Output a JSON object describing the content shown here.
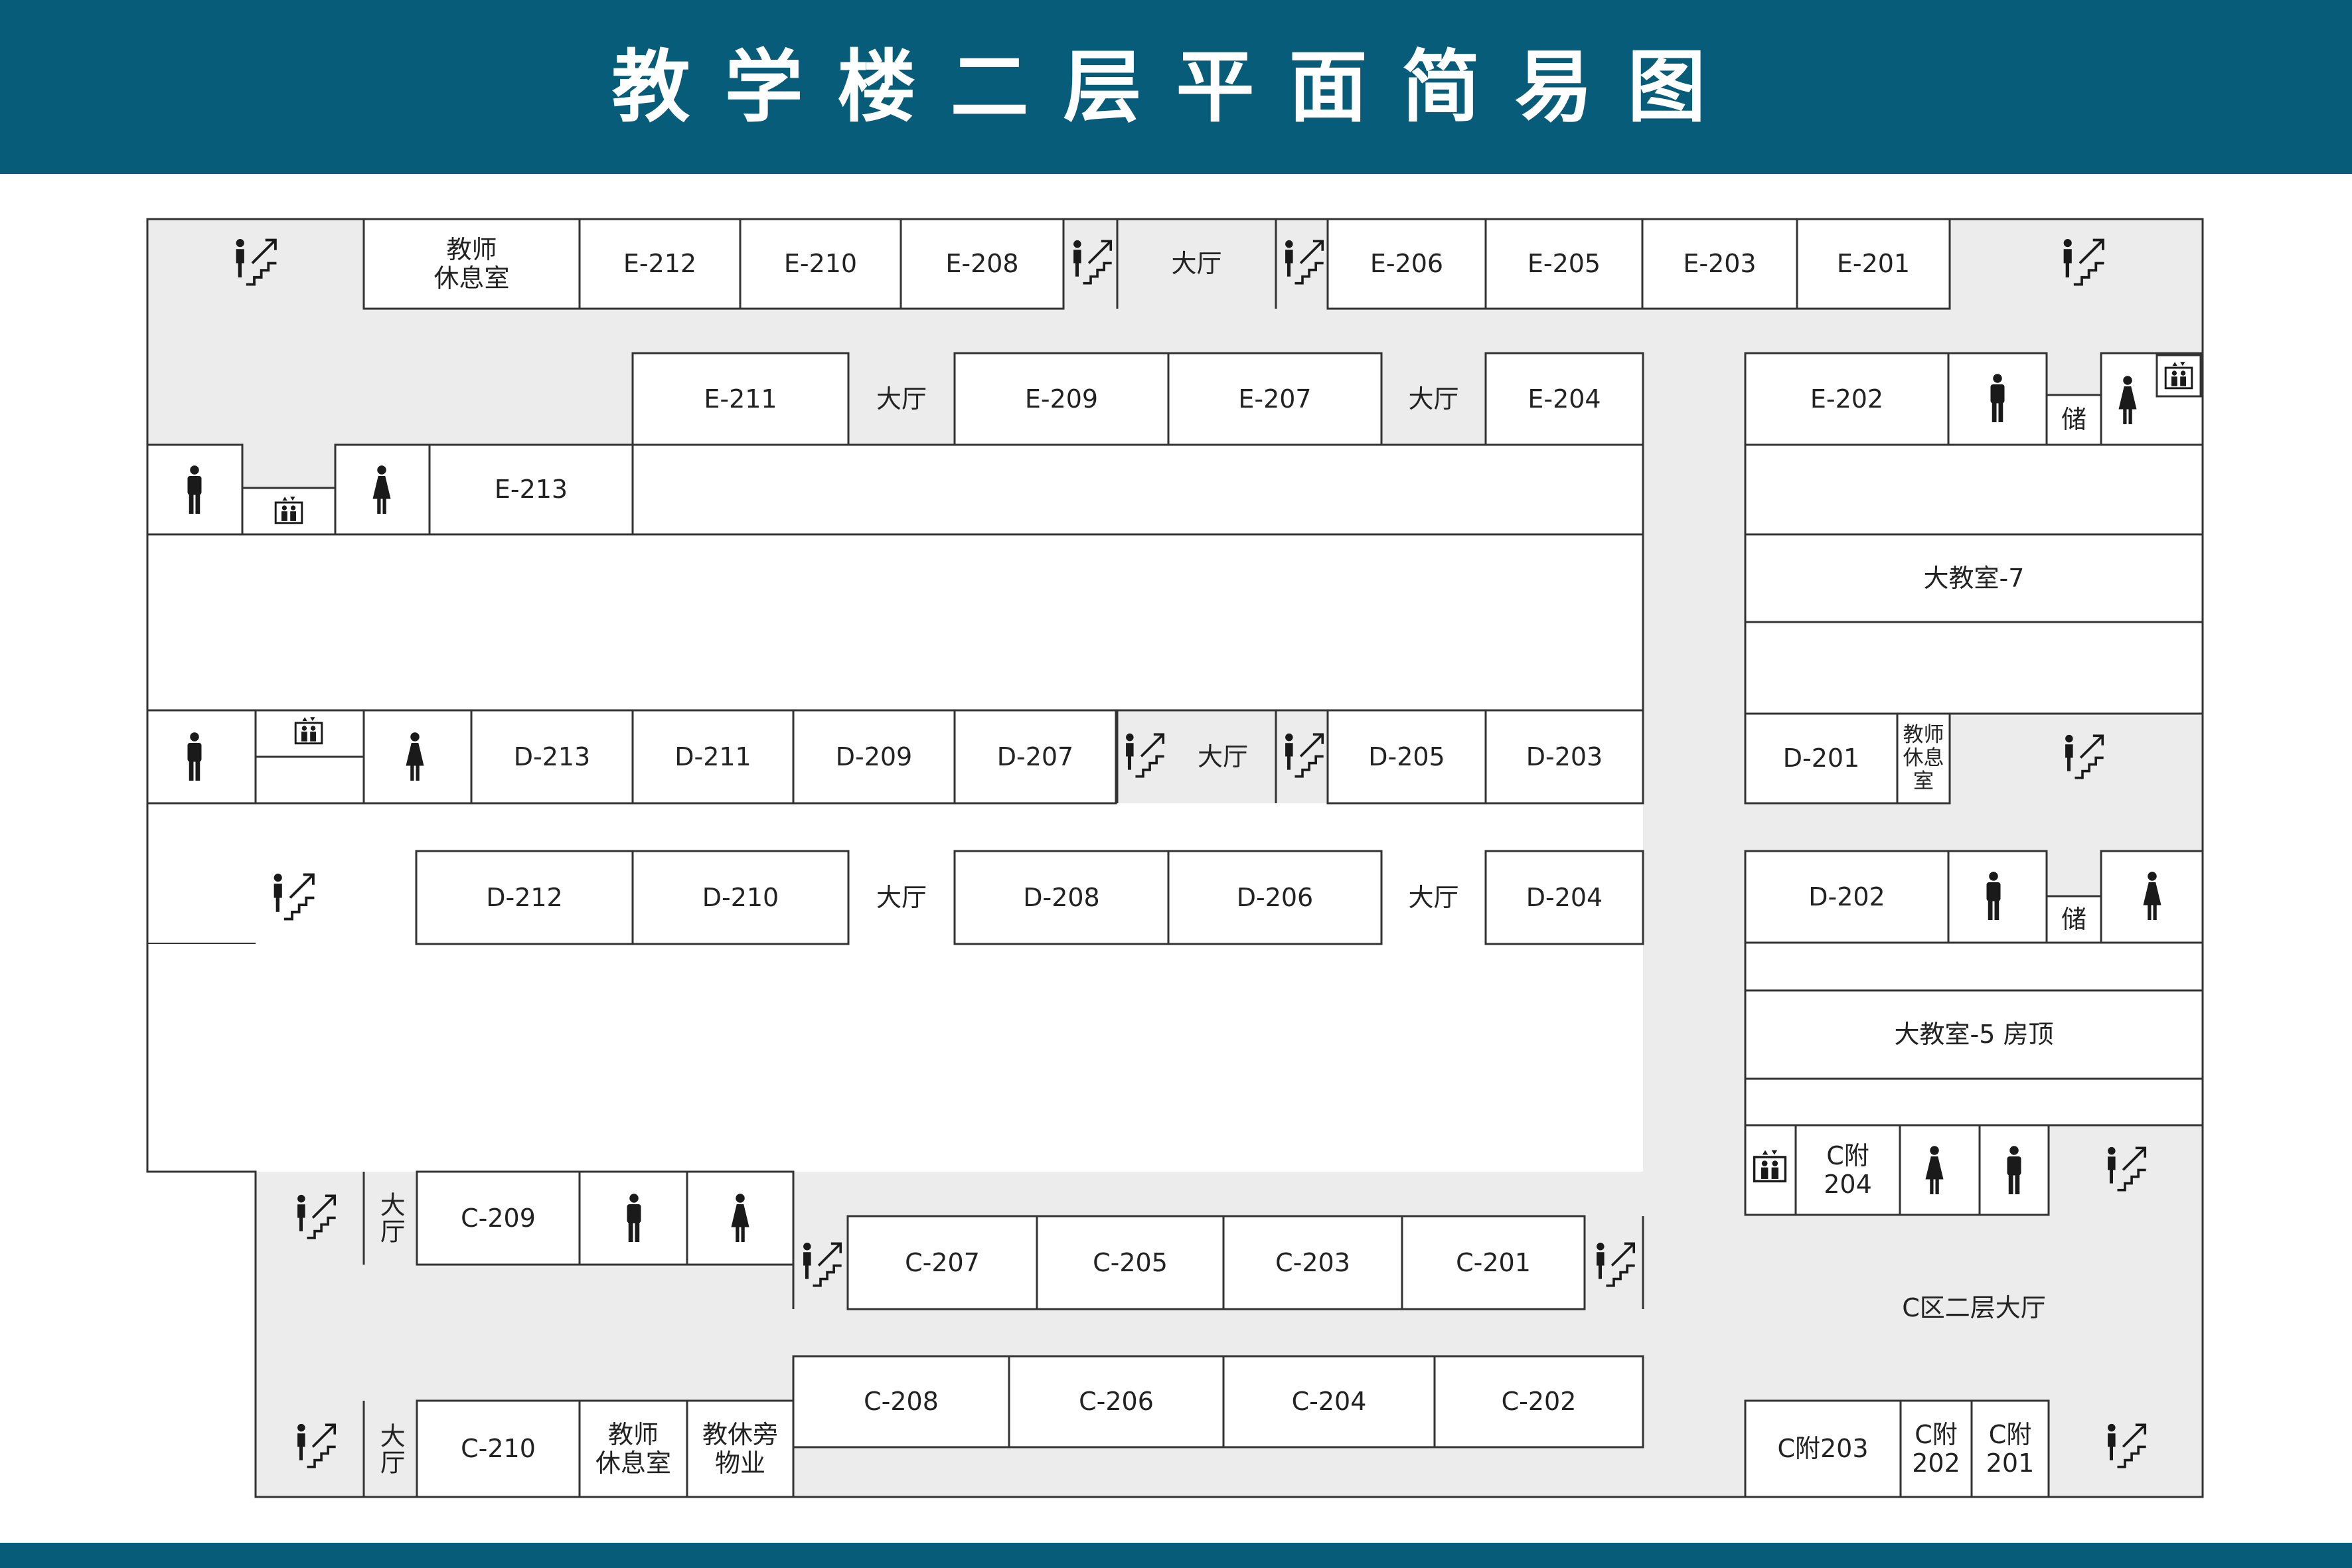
{
  "title": "教学楼二层平面简易图",
  "colors": {
    "header": "#075c7a",
    "hall": "#ececec",
    "wall": "#333333",
    "room": "#ffffff",
    "icon": "#1a1a1a"
  },
  "rooms": {
    "e212": "E-212",
    "e210": "E-210",
    "e208": "E-208",
    "e206": "E-206",
    "e205": "E-205",
    "e203": "E-203",
    "e201": "E-201",
    "e211": "E-211",
    "e209": "E-209",
    "e207": "E-207",
    "e204": "E-204",
    "e202": "E-202",
    "e213": "E-213",
    "d213": "D-213",
    "d211": "D-211",
    "d209": "D-209",
    "d207": "D-207",
    "d205": "D-205",
    "d203": "D-203",
    "d201": "D-201",
    "d212": "D-212",
    "d210": "D-210",
    "d208": "D-208",
    "d206": "D-206",
    "d204": "D-204",
    "d202": "D-202",
    "c209": "C-209",
    "c207": "C-207",
    "c205": "C-205",
    "c203": "C-203",
    "c201": "C-201",
    "c208": "C-208",
    "c206": "C-206",
    "c204": "C-204",
    "c202": "C-202",
    "c210": "C-210",
    "c204a": "C附\n204",
    "c203a": "C附203",
    "c202a": "C附\n202",
    "c201a": "C附\n201"
  },
  "labels": {
    "teacher_lounge": "教师\n休息室",
    "hall": "大厅",
    "storage": "储",
    "big_room_7": "大教室-7",
    "big_room_5": "大教室-5 房顶",
    "c_hall": "C区二层大厅",
    "c_property": "教休旁\n物业"
  },
  "icons": [
    "stairs-icon",
    "male-restroom-icon",
    "female-restroom-icon",
    "elevator-icon"
  ]
}
